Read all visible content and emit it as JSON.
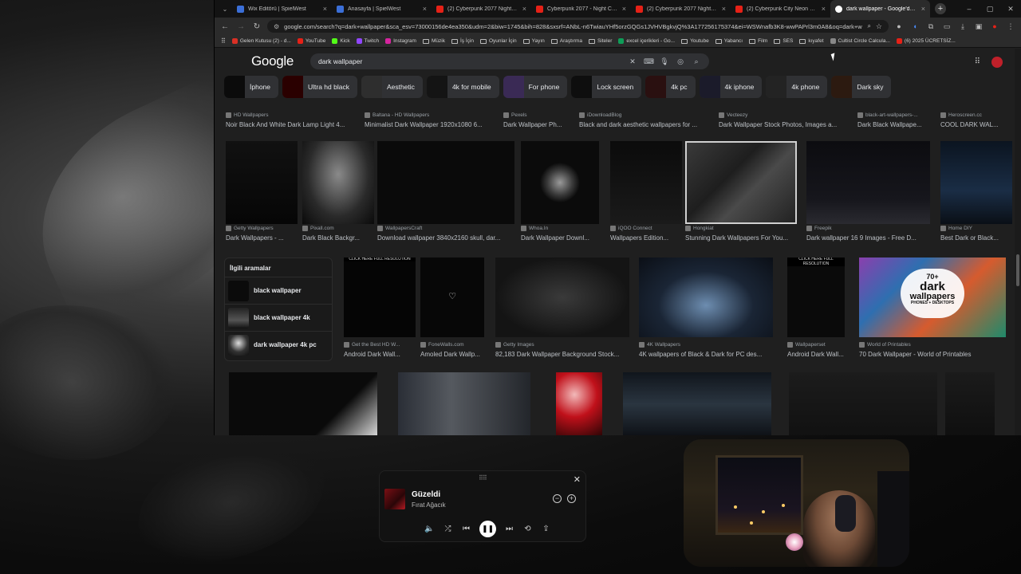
{
  "browser": {
    "tabs": [
      {
        "title": "Wix Editörü | SpielWest",
        "color": "#3b6fd8"
      },
      {
        "title": "Anasayfa | SpielWest",
        "color": "#3b6fd8"
      },
      {
        "title": "(2) Cyberpunk 2077 Night City",
        "color": "#e62117"
      },
      {
        "title": "Cyberpunk 2077 - Night City -",
        "color": "#e62117"
      },
      {
        "title": "(2) Cyberpunk 2077 Night City",
        "color": "#e62117"
      },
      {
        "title": "(2) Cyberpunk City Neon Night",
        "color": "#e62117"
      },
      {
        "title": "dark wallpaper - Google'da Ara",
        "color": "#ffffff"
      }
    ],
    "close_glyph": "×",
    "new_tab_glyph": "+",
    "window_controls": {
      "minimize": "–",
      "maximize": "▢",
      "close": "✕"
    },
    "url": "google.com/search?q=dark+wallpaper&sca_esv=73000156de4ea350&udm=2&biw=1745&bih=828&sxsrf=ANbL-n6TwiauYHf5orzGQGs1JVHVBgkvjQ%3A177256175374&ei=WSWnafb3K8-wwPAPrl3m0A8&oq=dark+wal&gs...",
    "url_domain": "google.com",
    "bookmarks": [
      {
        "label": "Gelen Kutusu (2) - d...",
        "icon": "mail-icon",
        "color": "#d93025"
      },
      {
        "label": "YouTube",
        "icon": "youtube-icon",
        "color": "#e62117"
      },
      {
        "label": "Kick",
        "icon": "kick-icon",
        "color": "#53fc18"
      },
      {
        "label": "Twitch",
        "icon": "twitch-icon",
        "color": "#9146ff"
      },
      {
        "label": "Instagram",
        "icon": "instagram-icon",
        "color": "#d6249f"
      },
      {
        "label": "Müzik",
        "icon": "folder-icon",
        "color": ""
      },
      {
        "label": "İş İçin",
        "icon": "folder-icon",
        "color": ""
      },
      {
        "label": "Oyunlar İçin",
        "icon": "folder-icon",
        "color": ""
      },
      {
        "label": "Yayın",
        "icon": "folder-icon",
        "color": ""
      },
      {
        "label": "Araştırma",
        "icon": "folder-icon",
        "color": ""
      },
      {
        "label": "Siteler",
        "icon": "folder-icon",
        "color": ""
      },
      {
        "label": "excel içerikleri - Go...",
        "icon": "sheets-icon",
        "color": "#0f9d58"
      },
      {
        "label": "Youtube",
        "icon": "folder-icon",
        "color": ""
      },
      {
        "label": "Yabancı",
        "icon": "folder-icon",
        "color": ""
      },
      {
        "label": "Film",
        "icon": "folder-icon",
        "color": ""
      },
      {
        "label": "SES",
        "icon": "folder-icon",
        "color": ""
      },
      {
        "label": "kıyafet",
        "icon": "folder-icon",
        "color": ""
      },
      {
        "label": "Cultist Circle Calcula...",
        "icon": "cultist-icon",
        "color": "#888888"
      },
      {
        "label": "(6) 2025 ÜCRETSİZ...",
        "icon": "youtube-icon",
        "color": "#e62117"
      }
    ]
  },
  "google": {
    "logo": "Google",
    "query": "dark wallpaper",
    "chips": [
      "İphone",
      "Ultra hd black",
      "Aesthetic",
      "4k for mobile",
      "For phone",
      "Lock screen",
      "4k pc",
      "4k iphone",
      "4k phone",
      "Dark sky"
    ],
    "row1": [
      {
        "source": "HD Wallpapers",
        "title": "Noir Black And White Dark Lamp Light 4..."
      },
      {
        "source": "Baltana - HD Wallpapers",
        "title": "Minimalist Dark Wallpaper 1920x1080 6..."
      },
      {
        "source": "Pexels",
        "title": "Dark Wallpaper Ph..."
      },
      {
        "source": "iDownloadBlog",
        "title": "Black and dark aesthetic wallpapers for ..."
      },
      {
        "source": "Vecteezy",
        "title": "Dark Wallpaper Stock Photos, Images a..."
      },
      {
        "source": "black-art-wallpapers-...",
        "title": "Dark Black Wallpape..."
      },
      {
        "source": "Heroscreen.cc",
        "title": "COOL DARK WAL..."
      }
    ],
    "row2": [
      {
        "source": "Getty Wallpapers",
        "title": "Dark Wallpapers - ..."
      },
      {
        "source": "Pixall.com",
        "title": "Dark Black Backgr..."
      },
      {
        "source": "WallpapersCraft",
        "title": "Download wallpaper 3840x2160 skull, dar..."
      },
      {
        "source": "Whoa.In",
        "title": "Dark Wallpaper Downl..."
      },
      {
        "source": "iQOO Connect",
        "title": "Wallpapers Edition..."
      },
      {
        "source": "Hongkiat",
        "title": "Stunning Dark Wallpapers For You..."
      },
      {
        "source": "Freepik",
        "title": "Dark wallpaper 16 9 Images - Free D..."
      },
      {
        "source": "Home DIY",
        "title": "Best Dark or Black..."
      }
    ],
    "related": {
      "heading": "İlgili aramalar",
      "items": [
        "black wallpaper",
        "black wallpaper 4k",
        "dark wallpaper 4k pc"
      ]
    },
    "row3": [
      {
        "source": "Get the Best HD W...",
        "title": "Android Dark Wall...",
        "banner": "CLICK HERE FULL RESOLUTION"
      },
      {
        "source": "FoneWalls.com",
        "title": "Amoled Dark Wallp...",
        "banner": ""
      },
      {
        "source": "Getty Images",
        "title": "82,183 Dark Wallpaper Background Stock...",
        "banner": ""
      },
      {
        "source": "4K Wallpapers",
        "title": "4K wallpapers of Black & Dark for PC des...",
        "banner": ""
      },
      {
        "source": "Wallpaperset",
        "title": "Android Dark Wall...",
        "banner": "CLICK HERE FULL RESOLUTION"
      },
      {
        "source": "World of Printables",
        "title": "70 Dark Wallpaper - World of Printables",
        "banner": ""
      }
    ],
    "promo": {
      "line1": "70+",
      "line2": "dark",
      "line3": "wallpapers",
      "line4": "PHONES + DESKTOPS"
    }
  },
  "player": {
    "song": "Güzeldi",
    "artist": "Fırat Ağacık",
    "grip_glyph": "⠿⠿",
    "close_glyph": "✕",
    "minus_glyph": "−",
    "plus_glyph": "+",
    "controls": {
      "volume": "🔈",
      "shuffle": "⤮",
      "prev": "⏮",
      "play_pause": "❚❚",
      "next": "⏭",
      "repeat": "⟲",
      "share": "⇪"
    }
  },
  "colors": {
    "accent": "#c0202a",
    "page_bg": "#1f1f1f",
    "chip_bg": "#303134"
  }
}
